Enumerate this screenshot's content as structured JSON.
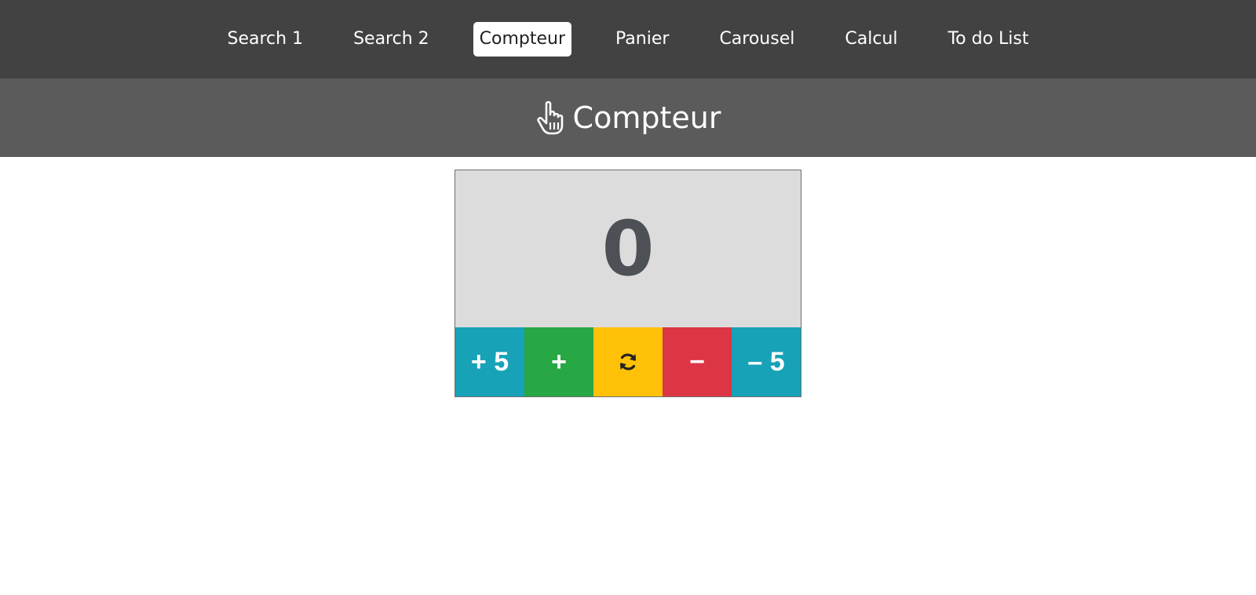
{
  "nav": {
    "items": [
      {
        "label": "Search 1",
        "active": false
      },
      {
        "label": "Search 2",
        "active": false
      },
      {
        "label": "Compteur",
        "active": true
      },
      {
        "label": "Panier",
        "active": false
      },
      {
        "label": "Carousel",
        "active": false
      },
      {
        "label": "Calcul",
        "active": false
      },
      {
        "label": "To do List",
        "active": false
      }
    ]
  },
  "header": {
    "title": "Compteur",
    "icon": "pointing-hand-icon"
  },
  "counter": {
    "value": "0",
    "buttons": [
      {
        "label": "+ 5",
        "name": "plus-five-button",
        "color": "#17a2b8"
      },
      {
        "label": "+",
        "name": "increment-button",
        "color": "#28a745"
      },
      {
        "label": "",
        "name": "reset-button",
        "color": "#ffc107",
        "icon": "sync-icon"
      },
      {
        "label": "−",
        "name": "decrement-button",
        "color": "#dc3545"
      },
      {
        "label": "– 5",
        "name": "minus-five-button",
        "color": "#17a2b8"
      }
    ]
  },
  "colors": {
    "navbar_bg": "#424242",
    "header_bg": "#5b5b5b",
    "display_bg": "#dcdcdc",
    "display_text": "#4d5155"
  }
}
